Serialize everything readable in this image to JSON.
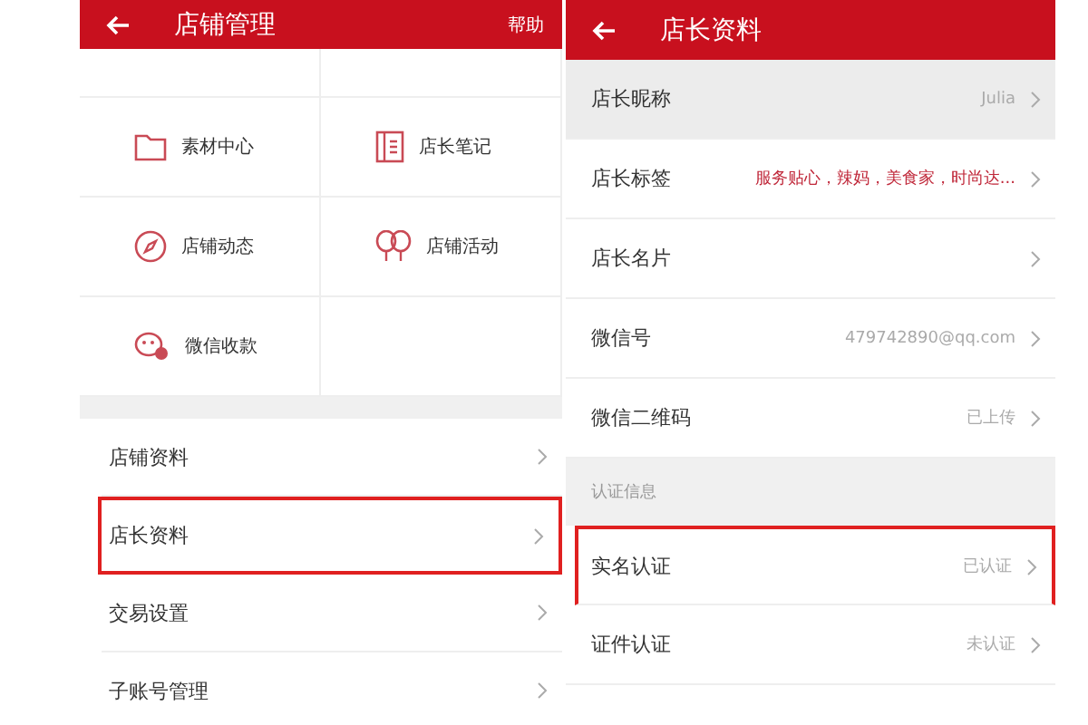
{
  "left": {
    "header": {
      "title": "店铺管理",
      "help": "帮助"
    },
    "grid": [
      {
        "label": "素材中心",
        "kind": "folder"
      },
      {
        "label": "店长笔记",
        "kind": "notebook"
      },
      {
        "label": "店铺动态",
        "kind": "compass"
      },
      {
        "label": "店铺活动",
        "kind": "balloons"
      },
      {
        "label": "微信收款",
        "kind": "wechat"
      }
    ],
    "list": [
      {
        "label": "店铺资料",
        "highlighted": false
      },
      {
        "label": "店长资料",
        "highlighted": true
      },
      {
        "label": "交易设置",
        "highlighted": false
      },
      {
        "label": "子账号管理",
        "highlighted": false
      }
    ]
  },
  "right": {
    "header": {
      "title": "店长资料"
    },
    "rows": [
      {
        "label": "店长昵称",
        "value": "Julia",
        "kind": "plain",
        "pressed": true
      },
      {
        "label": "店长标签",
        "value": "服务贴心，辣妈，美食家，时尚达...",
        "kind": "tags",
        "pressed": false
      },
      {
        "label": "店长名片",
        "kind": "plain",
        "pressed": false
      },
      {
        "label": "微信号",
        "value": "479742890@qq.com",
        "kind": "plain",
        "pressed": false
      },
      {
        "label": "微信二维码",
        "value": "已上传",
        "kind": "plain",
        "pressed": false
      }
    ],
    "section": "认证信息",
    "verification": [
      {
        "label": "实名认证",
        "value": "已认证",
        "highlighted": true
      },
      {
        "label": "证件认证",
        "value": "未认证",
        "highlighted": false
      }
    ]
  }
}
